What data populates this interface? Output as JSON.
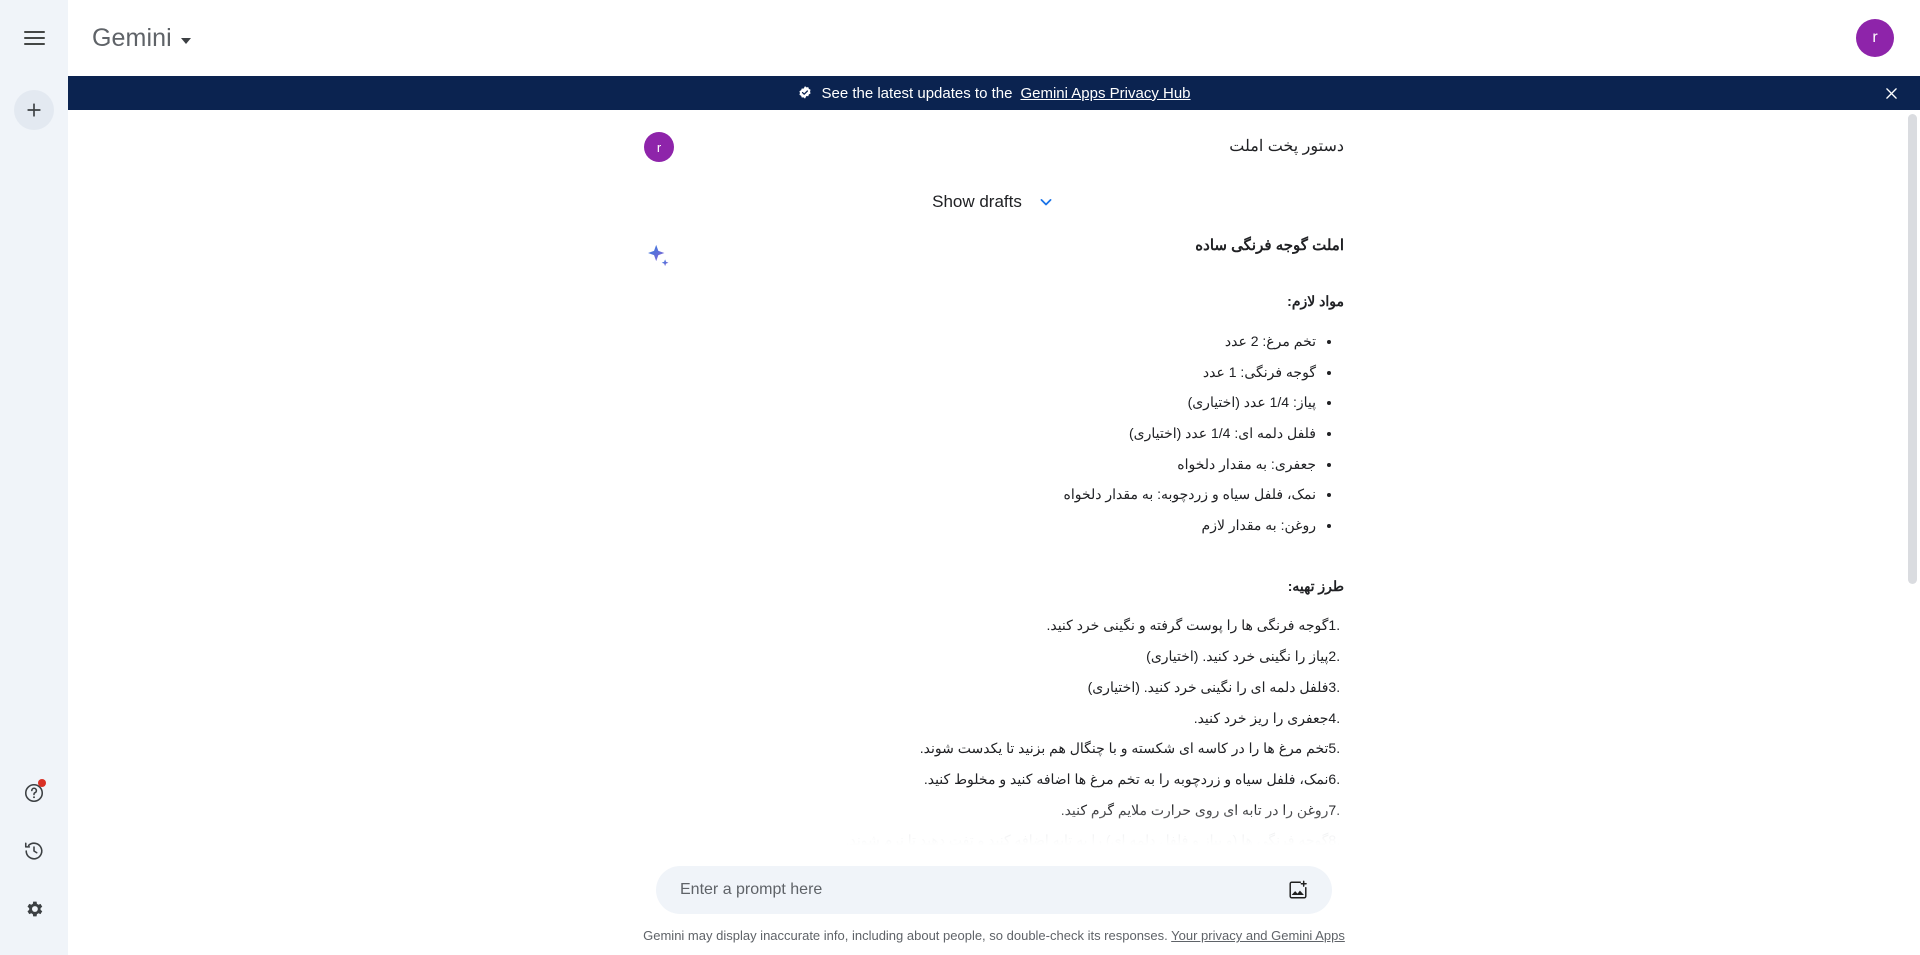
{
  "topbar": {
    "menu_icon": "hamburger-menu-icon",
    "brand": "Gemini",
    "brand_caret_icon": "caret-down-icon",
    "avatar_initial": "r"
  },
  "rail": {
    "new_chat_icon": "plus-icon",
    "help_icon": "help-circle-icon",
    "activity_icon": "history-clock-icon",
    "settings_icon": "gear-icon"
  },
  "banner": {
    "verified_icon": "verified-check-badge-icon",
    "text": "See the latest updates to the",
    "link": "Gemini Apps Privacy Hub",
    "close_icon": "close-x-icon",
    "bg_color": "#0b2350"
  },
  "conversation": {
    "user": {
      "avatar_initial": "r",
      "prompt": "دستور پخت املت"
    },
    "drafts": {
      "label": "Show drafts",
      "chevron_icon": "chevron-down-icon",
      "chevron_color": "#1a73e8"
    },
    "model": {
      "sparkle_icon": "gemini-sparkle-icon",
      "title": "املت گوجه فرنگی ساده",
      "ingredients_heading": "مواد لازم:",
      "ingredients": [
        "تخم مرغ: 2 عدد",
        "گوجه فرنگی: 1 عدد",
        "پیاز: 1/4 عدد (اختیاری)",
        "فلفل دلمه ای: 1/4 عدد (اختیاری)",
        "جعفری: به مقدار دلخواه",
        "نمک، فلفل سیاه و زردچوبه: به مقدار دلخواه",
        "روغن: به مقدار لازم"
      ],
      "method_heading": "طرز تهیه:",
      "steps": [
        "گوجه فرنگی ها را پوست گرفته و نگینی خرد کنید.",
        "پیاز را نگینی خرد کنید. (اختیاری)",
        "فلفل دلمه ای را نگینی خرد کنید. (اختیاری)",
        "جعفری را ریز خرد کنید.",
        "تخم مرغ ها را در کاسه ای شکسته و با چنگال هم بزنید تا یکدست شوند.",
        "نمک، فلفل سیاه و زردچوبه را به تخم مرغ ها اضافه کنید و مخلوط کنید.",
        "روغن را در تابه ای روی حرارت ملایم گرم کنید.",
        "گوجه فرنگی ها (و پیاز و فلفل دلمه ای) را به تابه اضافه کنید و تفت دهید تا نرم شوند."
      ]
    }
  },
  "composer": {
    "placeholder": "Enter a prompt here",
    "value": "",
    "image_icon": "add-image-icon"
  },
  "footer": {
    "disclaimer": "Gemini may display inaccurate info, including about people, so double-check its responses.",
    "link": "Your privacy and Gemini Apps"
  }
}
